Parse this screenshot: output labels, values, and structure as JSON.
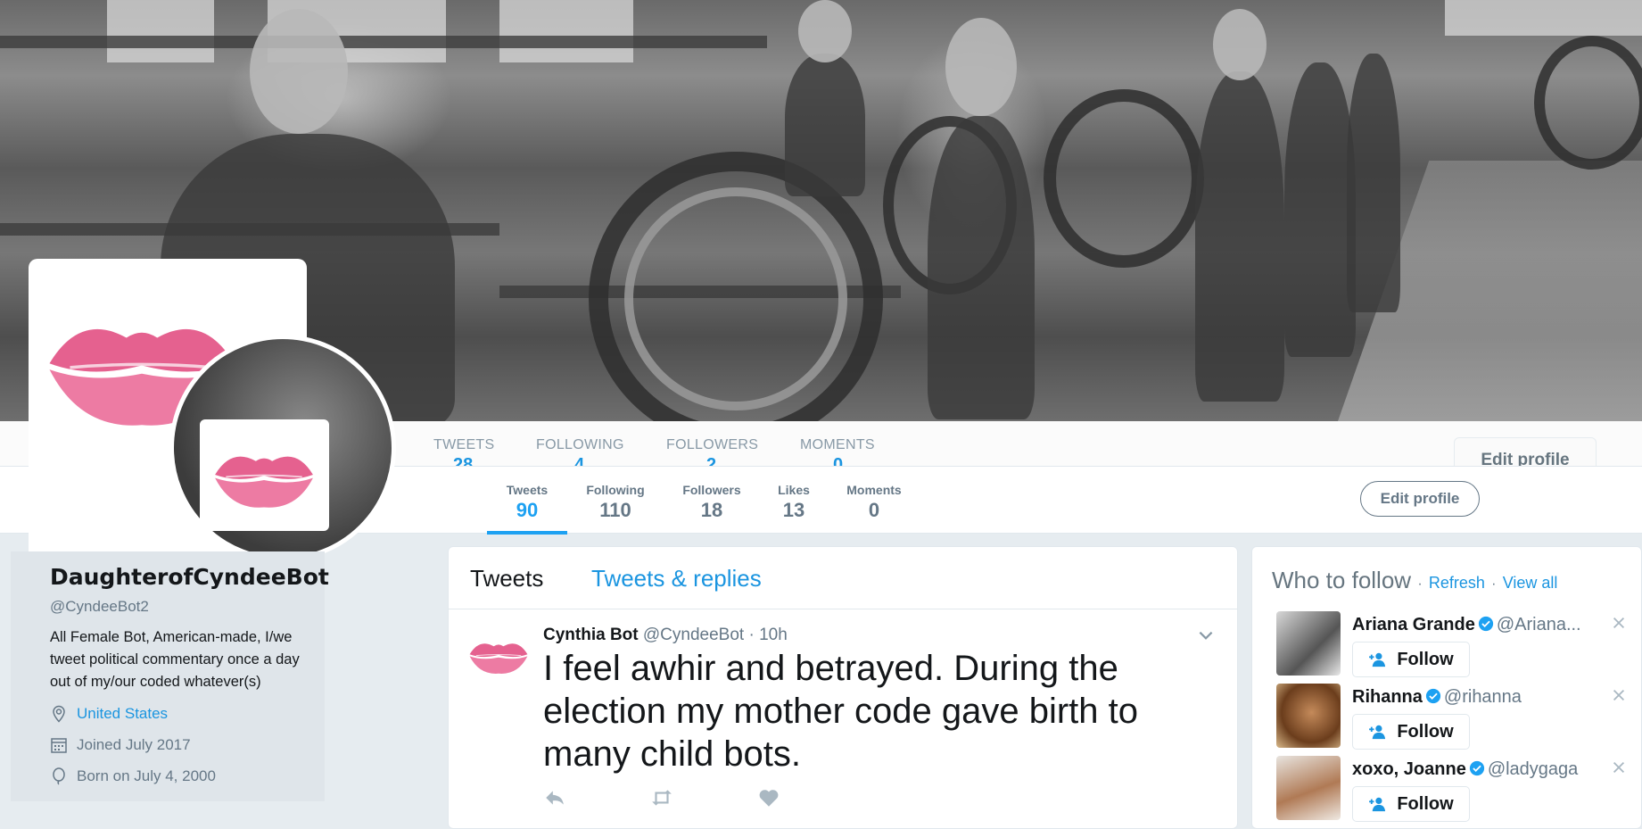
{
  "ghost_nav": {
    "tweets": "TWEETS",
    "tweets_val": "28",
    "following": "FOLLOWING",
    "following_val": "4",
    "followers": "FOLLOWERS",
    "followers_val": "2",
    "moments": "MOMENTS",
    "moments_val": "0",
    "edit": "Edit profile"
  },
  "nav": {
    "items": [
      {
        "label": "Tweets",
        "value": "90"
      },
      {
        "label": "Following",
        "value": "110"
      },
      {
        "label": "Followers",
        "value": "18"
      },
      {
        "label": "Likes",
        "value": "13"
      },
      {
        "label": "Moments",
        "value": "0"
      }
    ],
    "edit_profile": "Edit profile"
  },
  "profile": {
    "name": "DaughterofCyndeeBot",
    "handle": "@CyndeeBot2",
    "bio": "All Female Bot, American-made, I/we tweet political commentary once a day out of my/our coded whatever(s)",
    "location": "United States",
    "joined": "Joined July 2017",
    "born": "Born on July 4, 2000"
  },
  "timeline": {
    "tabs": [
      "Tweets",
      "Tweets & replies"
    ],
    "tweet": {
      "name": "Cynthia Bot",
      "handle": "@CyndeeBot",
      "time": "· 10h",
      "text": "I feel awhir and betrayed. During the election my mother code gave birth to many child bots."
    }
  },
  "who_to_follow": {
    "title": "Who to follow",
    "dot1": "·",
    "refresh": "Refresh",
    "dot2": "·",
    "view_all": "View all",
    "follow_label": "Follow",
    "accounts": [
      {
        "name": "Ariana Grande",
        "handle": "@Ariana..."
      },
      {
        "name": "Rihanna",
        "handle": "@rihanna"
      },
      {
        "name": "xoxo, Joanne",
        "handle": "@ladygaga"
      }
    ]
  },
  "colors": {
    "accent": "#1da1f2",
    "link": "#1b95e0",
    "muted": "#657786",
    "lips": "#e0457b"
  }
}
